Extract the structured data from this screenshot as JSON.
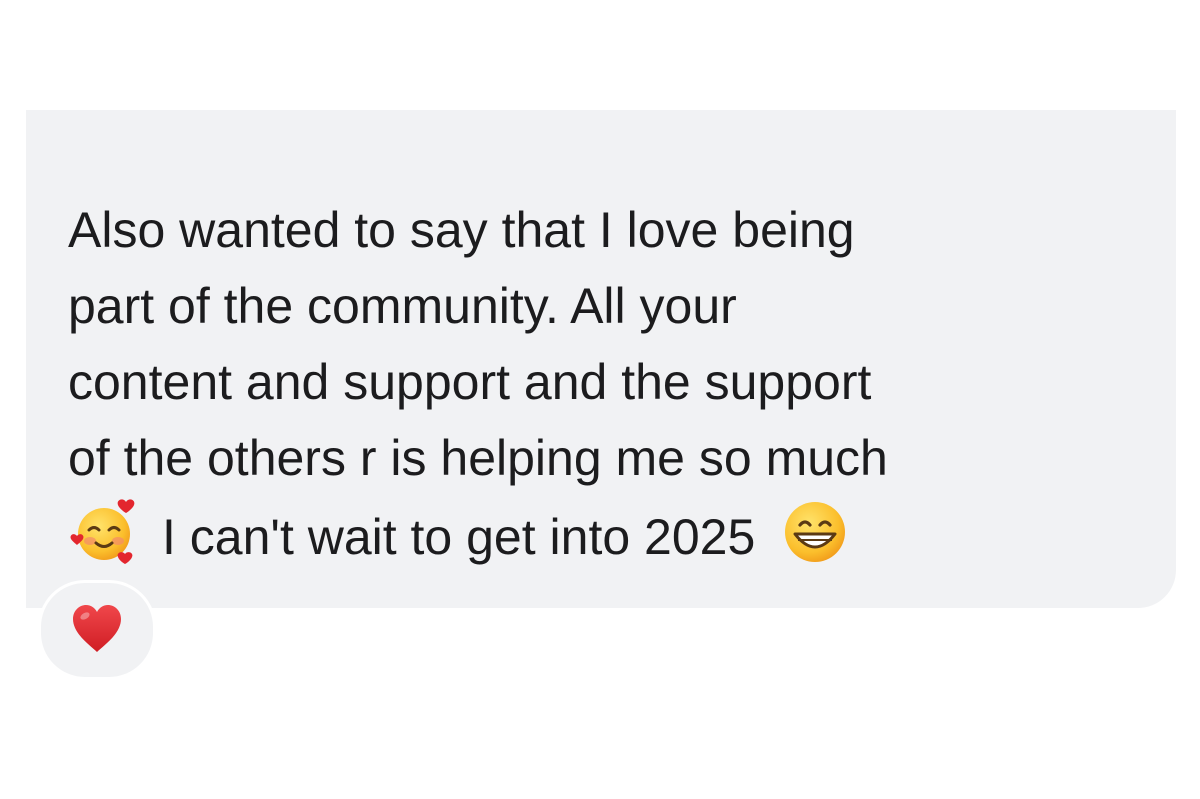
{
  "message": {
    "lines": [
      "Also wanted to say that I love being",
      "part of the community. All your",
      "content and support and the support",
      "of the others r is helping me so much"
    ],
    "last_line": "I can't wait to get into 2025",
    "emoji_before_last_line": "smiling-face-with-hearts-icon",
    "emoji_after_last_line": "grinning-face-icon",
    "bubble_color": "#f1f2f4",
    "text_color": "#1c1c1e"
  },
  "reaction": {
    "icon": "red-heart-icon",
    "color": "#e3262e"
  }
}
